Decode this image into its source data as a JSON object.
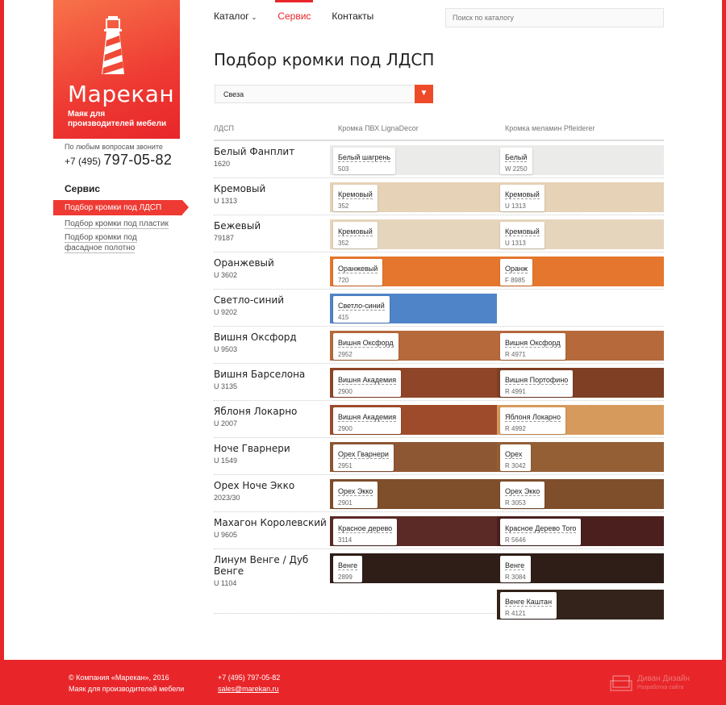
{
  "brand": {
    "name": "Марекан",
    "tagline": "Маяк для производителей мебели"
  },
  "contact": {
    "hint": "По любым вопросам звоните",
    "phone_prefix": "+7 (495)",
    "phone_main": "797-05-82"
  },
  "sidebar": {
    "title": "Сервис",
    "items": [
      {
        "label": "Подбор кромки под ЛДСП",
        "active": true
      },
      {
        "label": "Подбор кромки под пластик",
        "active": false
      },
      {
        "label": "Подбор кромки под фасадное полотно",
        "active": false
      }
    ]
  },
  "nav": {
    "catalog": "Каталог",
    "service": "Сервис",
    "contacts": "Контакты"
  },
  "search": {
    "placeholder": "Поиск по каталогу"
  },
  "page": {
    "title": "Подбор кромки под ЛДСП"
  },
  "filter": {
    "selected": "Свеза"
  },
  "table": {
    "headers": [
      "ЛДСП",
      "Кромка ПВХ LignaDecor",
      "Кромка меламин Pfleiderer"
    ],
    "rows": [
      {
        "name": "Белый Фанплит",
        "code": "1620",
        "color": "#ebebea",
        "pvc": [
          {
            "label": "Белый шагрень",
            "code": "503"
          }
        ],
        "mel": [
          {
            "label": "Белый",
            "code": "W 2250"
          }
        ]
      },
      {
        "name": "Кремовый",
        "code": "U 1313",
        "color": "#e6d2b7",
        "pvc": [
          {
            "label": "Кремовый",
            "code": "352"
          }
        ],
        "mel": [
          {
            "label": "Кремовый",
            "code": "U 1313"
          }
        ]
      },
      {
        "name": "Бежевый",
        "code": "79187",
        "color": "#e6d5bd",
        "pvc": [
          {
            "label": "Кремовый",
            "code": "352"
          }
        ],
        "mel": [
          {
            "label": "Кремовый",
            "code": "U 1313"
          }
        ]
      },
      {
        "name": "Оранжевый",
        "code": "U 3602",
        "color": "#e5762d",
        "pvc": [
          {
            "label": "Оранжевый",
            "code": "720"
          }
        ],
        "mel": [
          {
            "label": "Оранж",
            "code": "F 8985"
          }
        ]
      },
      {
        "name": "Светло-синий",
        "code": "U 9202",
        "color": "#5084c8",
        "pvc": [
          {
            "label": "Светло-синий",
            "code": "415"
          }
        ],
        "mel": []
      },
      {
        "name": "Вишня Оксфорд",
        "code": "U 9503",
        "color": "#b66a3c",
        "pvc": [
          {
            "label": "Вишня Оксфорд",
            "code": "2952"
          }
        ],
        "mel": [
          {
            "label": "Вишня Оксфорд",
            "code": "R 4971"
          }
        ]
      },
      {
        "name": "Вишня Барселона",
        "code": "U 3135",
        "color": "#8f4628",
        "pvc": [
          {
            "label": "Вишня Академия",
            "code": "2900"
          }
        ],
        "mel": [
          {
            "label": "Вишня Портофино",
            "code": "R 4991",
            "color": "#7e3f24"
          }
        ]
      },
      {
        "name": "Яблоня Локарно",
        "code": "U 2007",
        "color": "#9e4b2c",
        "pvc": [
          {
            "label": "Вишня Академия",
            "code": "2900"
          }
        ],
        "mel": [
          {
            "label": "Яблоня Локарно",
            "code": "R 4992",
            "color": "#d79a5d"
          }
        ]
      },
      {
        "name": "Ноче Гварнери",
        "code": "U 1549",
        "color": "#8e5733",
        "pvc": [
          {
            "label": "Орех Гварнери",
            "code": "2951"
          }
        ],
        "mel": [
          {
            "label": "Орех",
            "code": "R 3042",
            "color": "#955f36"
          }
        ]
      },
      {
        "name": "Орех Ноче Экко",
        "code": "2023/30",
        "color": "#7f4e2b",
        "pvc": [
          {
            "label": "Орех Экко",
            "code": "2901"
          }
        ],
        "mel": [
          {
            "label": "Орех Экко",
            "code": "R 3053"
          }
        ]
      },
      {
        "name": "Махагон Королевский",
        "code": "U 9605",
        "color": "#5b2a26",
        "pvc": [
          {
            "label": "Красное дерево",
            "code": "3114"
          }
        ],
        "mel": [
          {
            "label": "Красное Дерево Того",
            "code": "R 5646",
            "color": "#4a1f1e"
          }
        ]
      },
      {
        "name": "Линум Венге / Дуб Венге",
        "code": "U 1104",
        "color": "#2f1d17",
        "pvc": [
          {
            "label": "Венге",
            "code": "2899"
          }
        ],
        "mel": [
          {
            "label": "Венге",
            "code": "R 3084"
          },
          {
            "label": "Венге Каштан",
            "code": "R 4121",
            "color": "#34231a"
          }
        ]
      }
    ]
  },
  "footer": {
    "copyright": "© Компания «Марекан», 2016",
    "tagline": "Маяк для производителей мебели",
    "phone": "+7 (495) 797-05-82",
    "email": "sales@marekan.ru",
    "developer": "Диван Дизайн",
    "developer_sub": "Разработка сайта"
  }
}
